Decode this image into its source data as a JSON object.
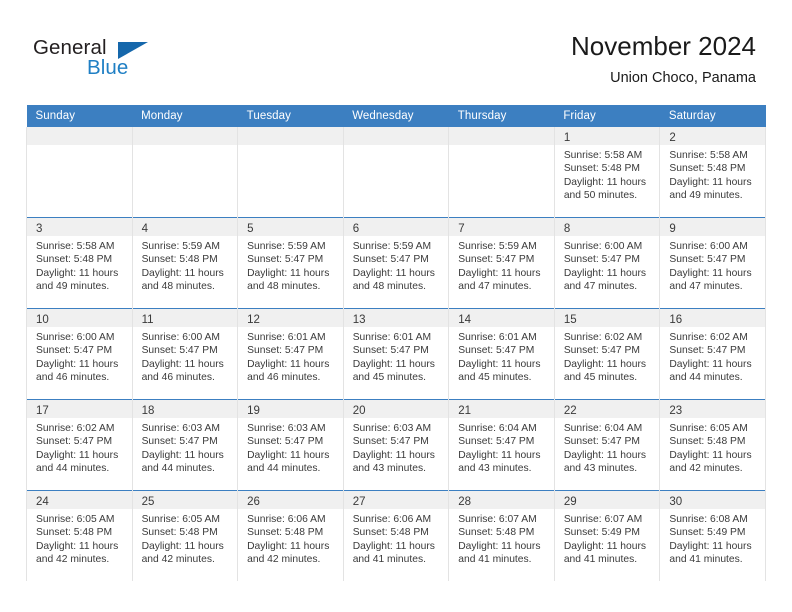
{
  "brand": {
    "name_dark": "General",
    "name_blue": "Blue",
    "accent_color": "#1567ab",
    "blue_text_color": "#1f7fc4"
  },
  "header": {
    "title": "November 2024",
    "subtitle": "Union Choco, Panama"
  },
  "theme": {
    "header_bg": "#3c7fc1",
    "header_text": "#ffffff",
    "daynum_strip_bg": "#f0f0f0",
    "cell_border": "#e3e3e3",
    "row_divider": "#3c7fc1",
    "body_text": "#3a3a3a"
  },
  "weekday_headers": [
    "Sunday",
    "Monday",
    "Tuesday",
    "Wednesday",
    "Thursday",
    "Friday",
    "Saturday"
  ],
  "weeks": [
    [
      {
        "day": "",
        "empty": true
      },
      {
        "day": "",
        "empty": true
      },
      {
        "day": "",
        "empty": true
      },
      {
        "day": "",
        "empty": true
      },
      {
        "day": "",
        "empty": true
      },
      {
        "day": "1",
        "sunrise": "Sunrise: 5:58 AM",
        "sunset": "Sunset: 5:48 PM",
        "daylight1": "Daylight: 11 hours",
        "daylight2": "and 50 minutes."
      },
      {
        "day": "2",
        "sunrise": "Sunrise: 5:58 AM",
        "sunset": "Sunset: 5:48 PM",
        "daylight1": "Daylight: 11 hours",
        "daylight2": "and 49 minutes."
      }
    ],
    [
      {
        "day": "3",
        "sunrise": "Sunrise: 5:58 AM",
        "sunset": "Sunset: 5:48 PM",
        "daylight1": "Daylight: 11 hours",
        "daylight2": "and 49 minutes."
      },
      {
        "day": "4",
        "sunrise": "Sunrise: 5:59 AM",
        "sunset": "Sunset: 5:48 PM",
        "daylight1": "Daylight: 11 hours",
        "daylight2": "and 48 minutes."
      },
      {
        "day": "5",
        "sunrise": "Sunrise: 5:59 AM",
        "sunset": "Sunset: 5:47 PM",
        "daylight1": "Daylight: 11 hours",
        "daylight2": "and 48 minutes."
      },
      {
        "day": "6",
        "sunrise": "Sunrise: 5:59 AM",
        "sunset": "Sunset: 5:47 PM",
        "daylight1": "Daylight: 11 hours",
        "daylight2": "and 48 minutes."
      },
      {
        "day": "7",
        "sunrise": "Sunrise: 5:59 AM",
        "sunset": "Sunset: 5:47 PM",
        "daylight1": "Daylight: 11 hours",
        "daylight2": "and 47 minutes."
      },
      {
        "day": "8",
        "sunrise": "Sunrise: 6:00 AM",
        "sunset": "Sunset: 5:47 PM",
        "daylight1": "Daylight: 11 hours",
        "daylight2": "and 47 minutes."
      },
      {
        "day": "9",
        "sunrise": "Sunrise: 6:00 AM",
        "sunset": "Sunset: 5:47 PM",
        "daylight1": "Daylight: 11 hours",
        "daylight2": "and 47 minutes."
      }
    ],
    [
      {
        "day": "10",
        "sunrise": "Sunrise: 6:00 AM",
        "sunset": "Sunset: 5:47 PM",
        "daylight1": "Daylight: 11 hours",
        "daylight2": "and 46 minutes."
      },
      {
        "day": "11",
        "sunrise": "Sunrise: 6:00 AM",
        "sunset": "Sunset: 5:47 PM",
        "daylight1": "Daylight: 11 hours",
        "daylight2": "and 46 minutes."
      },
      {
        "day": "12",
        "sunrise": "Sunrise: 6:01 AM",
        "sunset": "Sunset: 5:47 PM",
        "daylight1": "Daylight: 11 hours",
        "daylight2": "and 46 minutes."
      },
      {
        "day": "13",
        "sunrise": "Sunrise: 6:01 AM",
        "sunset": "Sunset: 5:47 PM",
        "daylight1": "Daylight: 11 hours",
        "daylight2": "and 45 minutes."
      },
      {
        "day": "14",
        "sunrise": "Sunrise: 6:01 AM",
        "sunset": "Sunset: 5:47 PM",
        "daylight1": "Daylight: 11 hours",
        "daylight2": "and 45 minutes."
      },
      {
        "day": "15",
        "sunrise": "Sunrise: 6:02 AM",
        "sunset": "Sunset: 5:47 PM",
        "daylight1": "Daylight: 11 hours",
        "daylight2": "and 45 minutes."
      },
      {
        "day": "16",
        "sunrise": "Sunrise: 6:02 AM",
        "sunset": "Sunset: 5:47 PM",
        "daylight1": "Daylight: 11 hours",
        "daylight2": "and 44 minutes."
      }
    ],
    [
      {
        "day": "17",
        "sunrise": "Sunrise: 6:02 AM",
        "sunset": "Sunset: 5:47 PM",
        "daylight1": "Daylight: 11 hours",
        "daylight2": "and 44 minutes."
      },
      {
        "day": "18",
        "sunrise": "Sunrise: 6:03 AM",
        "sunset": "Sunset: 5:47 PM",
        "daylight1": "Daylight: 11 hours",
        "daylight2": "and 44 minutes."
      },
      {
        "day": "19",
        "sunrise": "Sunrise: 6:03 AM",
        "sunset": "Sunset: 5:47 PM",
        "daylight1": "Daylight: 11 hours",
        "daylight2": "and 44 minutes."
      },
      {
        "day": "20",
        "sunrise": "Sunrise: 6:03 AM",
        "sunset": "Sunset: 5:47 PM",
        "daylight1": "Daylight: 11 hours",
        "daylight2": "and 43 minutes."
      },
      {
        "day": "21",
        "sunrise": "Sunrise: 6:04 AM",
        "sunset": "Sunset: 5:47 PM",
        "daylight1": "Daylight: 11 hours",
        "daylight2": "and 43 minutes."
      },
      {
        "day": "22",
        "sunrise": "Sunrise: 6:04 AM",
        "sunset": "Sunset: 5:47 PM",
        "daylight1": "Daylight: 11 hours",
        "daylight2": "and 43 minutes."
      },
      {
        "day": "23",
        "sunrise": "Sunrise: 6:05 AM",
        "sunset": "Sunset: 5:48 PM",
        "daylight1": "Daylight: 11 hours",
        "daylight2": "and 42 minutes."
      }
    ],
    [
      {
        "day": "24",
        "sunrise": "Sunrise: 6:05 AM",
        "sunset": "Sunset: 5:48 PM",
        "daylight1": "Daylight: 11 hours",
        "daylight2": "and 42 minutes."
      },
      {
        "day": "25",
        "sunrise": "Sunrise: 6:05 AM",
        "sunset": "Sunset: 5:48 PM",
        "daylight1": "Daylight: 11 hours",
        "daylight2": "and 42 minutes."
      },
      {
        "day": "26",
        "sunrise": "Sunrise: 6:06 AM",
        "sunset": "Sunset: 5:48 PM",
        "daylight1": "Daylight: 11 hours",
        "daylight2": "and 42 minutes."
      },
      {
        "day": "27",
        "sunrise": "Sunrise: 6:06 AM",
        "sunset": "Sunset: 5:48 PM",
        "daylight1": "Daylight: 11 hours",
        "daylight2": "and 41 minutes."
      },
      {
        "day": "28",
        "sunrise": "Sunrise: 6:07 AM",
        "sunset": "Sunset: 5:48 PM",
        "daylight1": "Daylight: 11 hours",
        "daylight2": "and 41 minutes."
      },
      {
        "day": "29",
        "sunrise": "Sunrise: 6:07 AM",
        "sunset": "Sunset: 5:49 PM",
        "daylight1": "Daylight: 11 hours",
        "daylight2": "and 41 minutes."
      },
      {
        "day": "30",
        "sunrise": "Sunrise: 6:08 AM",
        "sunset": "Sunset: 5:49 PM",
        "daylight1": "Daylight: 11 hours",
        "daylight2": "and 41 minutes."
      }
    ]
  ]
}
